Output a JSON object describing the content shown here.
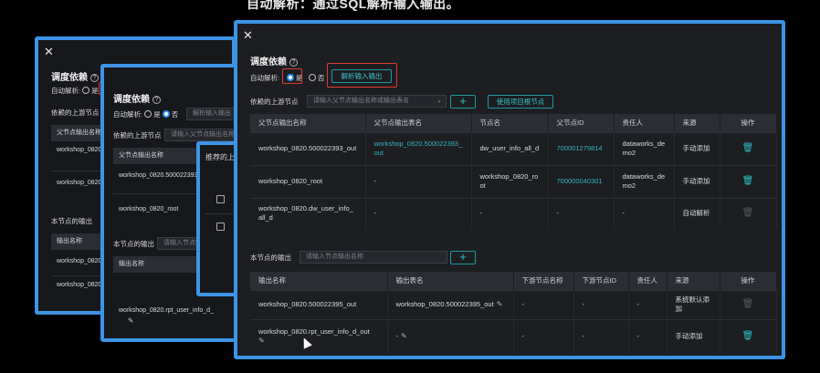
{
  "caption": "自动解析：通过SQL解析输入输出。",
  "back1": {
    "title": "调度依赖",
    "auto_parse_label": "自动解析:",
    "radio_yes": "是",
    "upstream_label": "依赖的上游节点",
    "col_parent_output": "父节点输出名称",
    "rows": [
      "workshop_0820.500022393_out",
      "workshop_0820_root"
    ],
    "output_label": "本节点的输出",
    "col_output_name": "输出名称",
    "out_rows": [
      "workshop_0820.500022395_out",
      "workshop_0820.rpt_user_info_d_out"
    ]
  },
  "back2": {
    "title": "调度依赖",
    "auto_parse_label": "自动解析:",
    "radio_yes": "是",
    "radio_no": "否",
    "parse_btn": "解析输入输出",
    "upstream_label": "依赖的上游节点",
    "upstream_placeholder": "请输入父节点输出名称或输出表名",
    "col_parent_output": "父节点输出名称",
    "rows": [
      "workshop_0820.500022393_out",
      "workshop_0820_root"
    ],
    "output_label": "本节点的输出",
    "output_placeholder": "请输入节点输出名称",
    "col_output_name": "输出名称",
    "out_rows": [
      "workshop_0820.rpt_user_info_d_out"
    ]
  },
  "back3": {
    "title": "推荐的上游节点"
  },
  "main": {
    "title": "调度依赖",
    "auto_parse_label": "自动解析:",
    "radio_yes": "是",
    "radio_no": "否",
    "parse_btn": "解析输入输出",
    "upstream_label": "依赖的上游节点",
    "upstream_placeholder": "请输入父节点输出名称或输出表名",
    "use_root_btn": "使用项目根节点",
    "upstream_headers": [
      "父节点输出名称",
      "父节点输出表名",
      "节点名",
      "父节点ID",
      "责任人",
      "来源",
      "操作"
    ],
    "upstream_rows": [
      {
        "output": "workshop_0820.500022393_out",
        "table": "workshop_0820.500022393_out",
        "node": "dw_user_info_all_d",
        "id": "700001279814",
        "owner": "dataworks_demo2",
        "source": "手动添加"
      },
      {
        "output": "workshop_0820_root",
        "table": "-",
        "node": "workshop_0820_root",
        "id": "700000040301",
        "owner": "dataworks_demo2",
        "source": "手动添加"
      },
      {
        "output": "workshop_0820.dw_user_info_all_d",
        "table": "-",
        "node": "-",
        "id": "-",
        "owner": "-",
        "source": "自动解析"
      }
    ],
    "output_label": "本节点的输出",
    "output_placeholder": "请输入节点输出名称",
    "output_headers": [
      "输出名称",
      "输出表名",
      "下游节点名称",
      "下游节点ID",
      "责任人",
      "来源",
      "操作"
    ],
    "output_rows": [
      {
        "name": "workshop_0820.500022395_out",
        "table": "workshop_0820.500022395_out",
        "down_name": "-",
        "down_id": "-",
        "owner": "-",
        "source": "系统默认添加"
      },
      {
        "name": "workshop_0820.rpt_user_info_d_out",
        "table": "-",
        "down_name": "-",
        "down_id": "-",
        "owner": "-",
        "source": "手动添加"
      }
    ]
  }
}
